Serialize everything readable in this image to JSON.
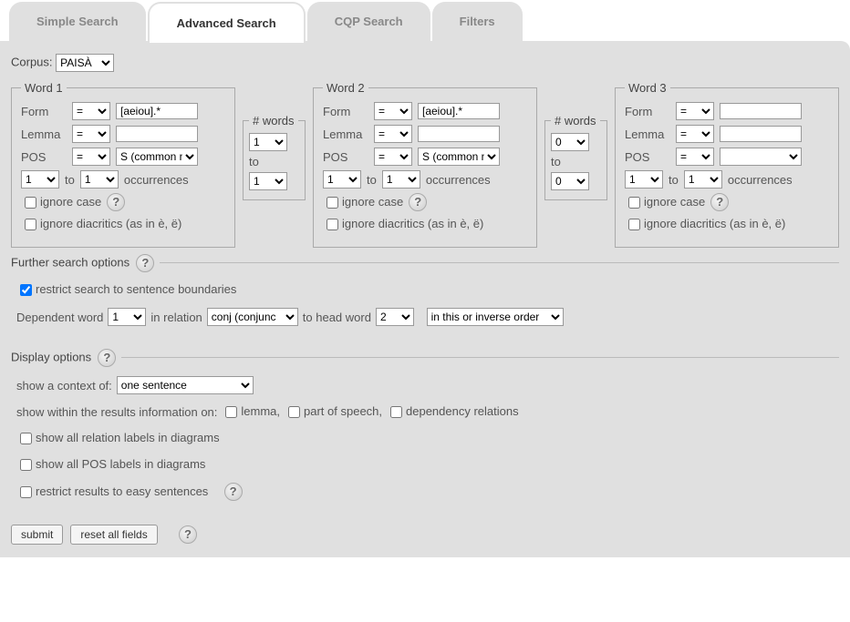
{
  "tabs": {
    "simple": "Simple Search",
    "advanced": "Advanced Search",
    "cqp": "CQP Search",
    "filters": "Filters"
  },
  "corpus": {
    "label": "Corpus:",
    "value": "PAISÀ"
  },
  "words": [
    {
      "legend": "Word 1",
      "form_label": "Form",
      "form_op": "=",
      "form_value": "[aeiou].*",
      "lemma_label": "Lemma",
      "lemma_op": "=",
      "lemma_value": "",
      "pos_label": "POS",
      "pos_op": "=",
      "pos_value": "S (common n",
      "occ_from": "1",
      "occ_to_label": "to",
      "occ_to": "1",
      "occ_label": "occurrences",
      "ignore_case": "ignore case",
      "ignore_diac": "ignore diacritics (as in è, ë)"
    },
    {
      "legend": "Word 2",
      "form_label": "Form",
      "form_op": "=",
      "form_value": "[aeiou].*",
      "lemma_label": "Lemma",
      "lemma_op": "=",
      "lemma_value": "",
      "pos_label": "POS",
      "pos_op": "=",
      "pos_value": "S (common n",
      "occ_from": "1",
      "occ_to_label": "to",
      "occ_to": "1",
      "occ_label": "occurrences",
      "ignore_case": "ignore case",
      "ignore_diac": "ignore diacritics (as in è, ë)"
    },
    {
      "legend": "Word 3",
      "form_label": "Form",
      "form_op": "=",
      "form_value": "",
      "lemma_label": "Lemma",
      "lemma_op": "=",
      "lemma_value": "",
      "pos_label": "POS",
      "pos_op": "=",
      "pos_value": "",
      "occ_from": "1",
      "occ_to_label": "to",
      "occ_to": "1",
      "occ_label": "occurrences",
      "ignore_case": "ignore case",
      "ignore_diac": "ignore diacritics (as in è, ë)"
    }
  ],
  "betweens": [
    {
      "legend": "# words",
      "from": "1",
      "to_label": "to",
      "to": "1"
    },
    {
      "legend": "# words",
      "from": "0",
      "to_label": "to",
      "to": "0"
    }
  ],
  "further": {
    "legend": "Further search options",
    "restrict": "restrict search to sentence boundaries",
    "dep_label": "Dependent word",
    "dep_word": "1",
    "in_relation": "in relation",
    "relation": "conj (conjunc",
    "to_head": "to head word",
    "head_word": "2",
    "order": "in this or inverse order"
  },
  "display": {
    "legend": "Display options",
    "context_label": "show a context of:",
    "context": "one sentence",
    "info_label": "show within the results information on:",
    "lemma": "lemma,",
    "pos": "part of speech,",
    "dep": "dependency relations",
    "rel_labels": "show all relation labels in diagrams",
    "pos_labels": "show all POS labels in diagrams",
    "easy": "restrict results to easy sentences"
  },
  "buttons": {
    "submit": "submit",
    "reset": "reset all fields"
  }
}
